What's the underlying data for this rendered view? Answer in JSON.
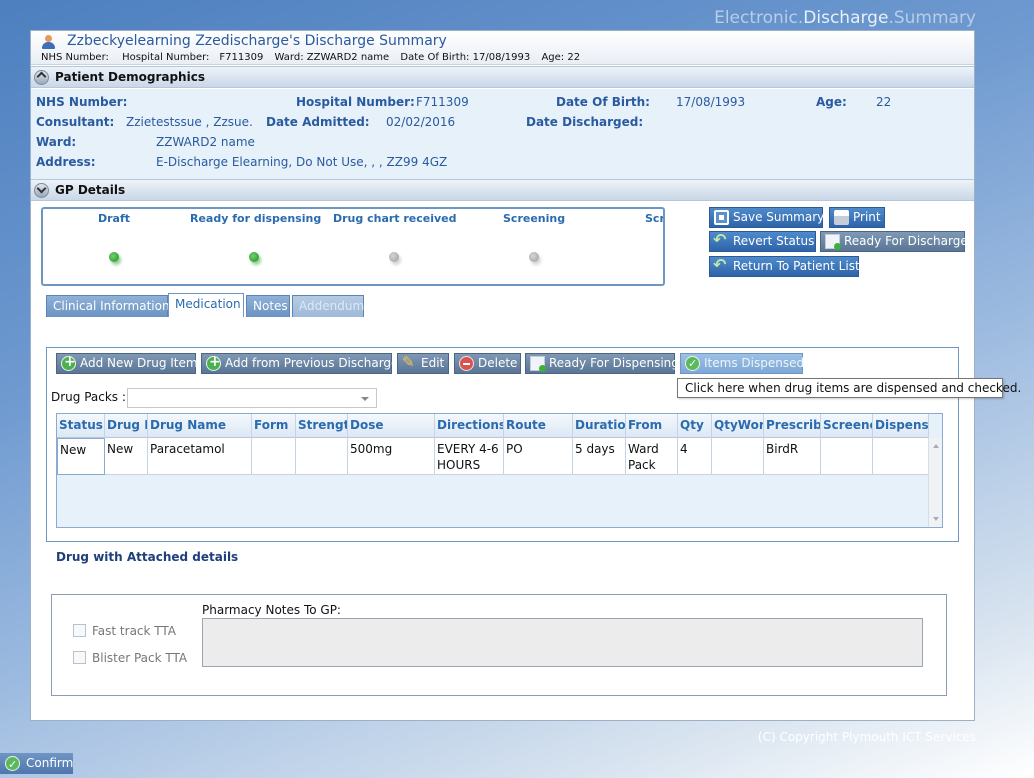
{
  "brand": {
    "part1": "Electronic.",
    "part2": "Discharge",
    "part3": ".Summary"
  },
  "header": {
    "title": "Zzbeckyelearning Zzedischarge's Discharge Summary",
    "nhs_label": "NHS Number:",
    "hospital_label": "Hospital Number:",
    "hospital_value": "F711309",
    "ward_label": "Ward:",
    "ward_value": "ZZWARD2 name",
    "dob_label": "Date Of Birth:",
    "dob_value": "17/08/1993",
    "age_label": "Age:",
    "age_value": "22"
  },
  "demographics": {
    "section_title": "Patient Demographics",
    "nhs_label": "NHS Number:",
    "hospital_label": "Hospital Number:",
    "hospital_value": "F711309",
    "dob_label": "Date Of Birth:",
    "dob_value": "17/08/1993",
    "age_label": "Age:",
    "age_value": "22",
    "consultant_label": "Consultant:",
    "consultant_value": "Zzietestssue , Zzsue.",
    "admitted_label": "Date Admitted:",
    "admitted_value": "02/02/2016",
    "discharged_label": "Date Discharged:",
    "ward_label": "Ward:",
    "ward_value": "ZZWARD2 name",
    "address_label": "Address:",
    "address_value": "E-Discharge Elearning, Do Not Use, , , ZZ99 4GZ"
  },
  "gp": {
    "section_title": "GP Details"
  },
  "status_steps": [
    {
      "label": "Draft",
      "state": "complete"
    },
    {
      "label": "Ready for dispensing",
      "state": "complete"
    },
    {
      "label": "Drug chart received",
      "state": "pending"
    },
    {
      "label": "Screening",
      "state": "pending"
    },
    {
      "label": "Scr",
      "state": "pending"
    }
  ],
  "actions": {
    "save_summary": "Save Summary",
    "print": "Print",
    "revert_status": "Revert Status",
    "ready_for_discharge": "Ready For Discharge",
    "return_to_list": "Return To Patient List"
  },
  "tabs": [
    {
      "label": "Clinical Information"
    },
    {
      "label": "Medication"
    },
    {
      "label": "Notes"
    },
    {
      "label": "Addendum"
    }
  ],
  "medication": {
    "toolbar": {
      "add_new": "Add New Drug Item",
      "add_previous": "Add from Previous Discharge",
      "edit": "Edit",
      "delete": "Delete",
      "ready_dispensing": "Ready For Dispensing",
      "items_dispensed": "Items Dispensed"
    },
    "tooltip": "Click here when drug items are dispensed and checked.",
    "drug_packs_label": "Drug Packs :",
    "drug_packs_value": "",
    "columns": [
      "Status",
      "Drug I",
      "Drug Name",
      "Form",
      "Strengtl",
      "Dose",
      "Directions",
      "Route",
      "Duratior",
      "From",
      "Qty",
      "QtyWor",
      "Prescribe",
      "Screene",
      "Dispens"
    ],
    "rows": [
      {
        "cells": [
          "New",
          "New",
          "Paracetamol",
          "",
          "",
          "500mg",
          "EVERY 4-6 HOURS",
          "PO",
          "5 days",
          "Ward Pack",
          "4",
          "",
          "BirdR",
          "",
          ""
        ]
      }
    ],
    "attached_title": "Drug with Attached details",
    "fast_track_label": "Fast track TTA",
    "blister_label": "Blister Pack TTA",
    "pharmacy_notes_label": "Pharmacy Notes To GP:",
    "pharmacy_notes_value": ""
  },
  "footer": {
    "copyright": "(C) Copyright Plymouth ICT Services",
    "confirm": "Confirm"
  }
}
